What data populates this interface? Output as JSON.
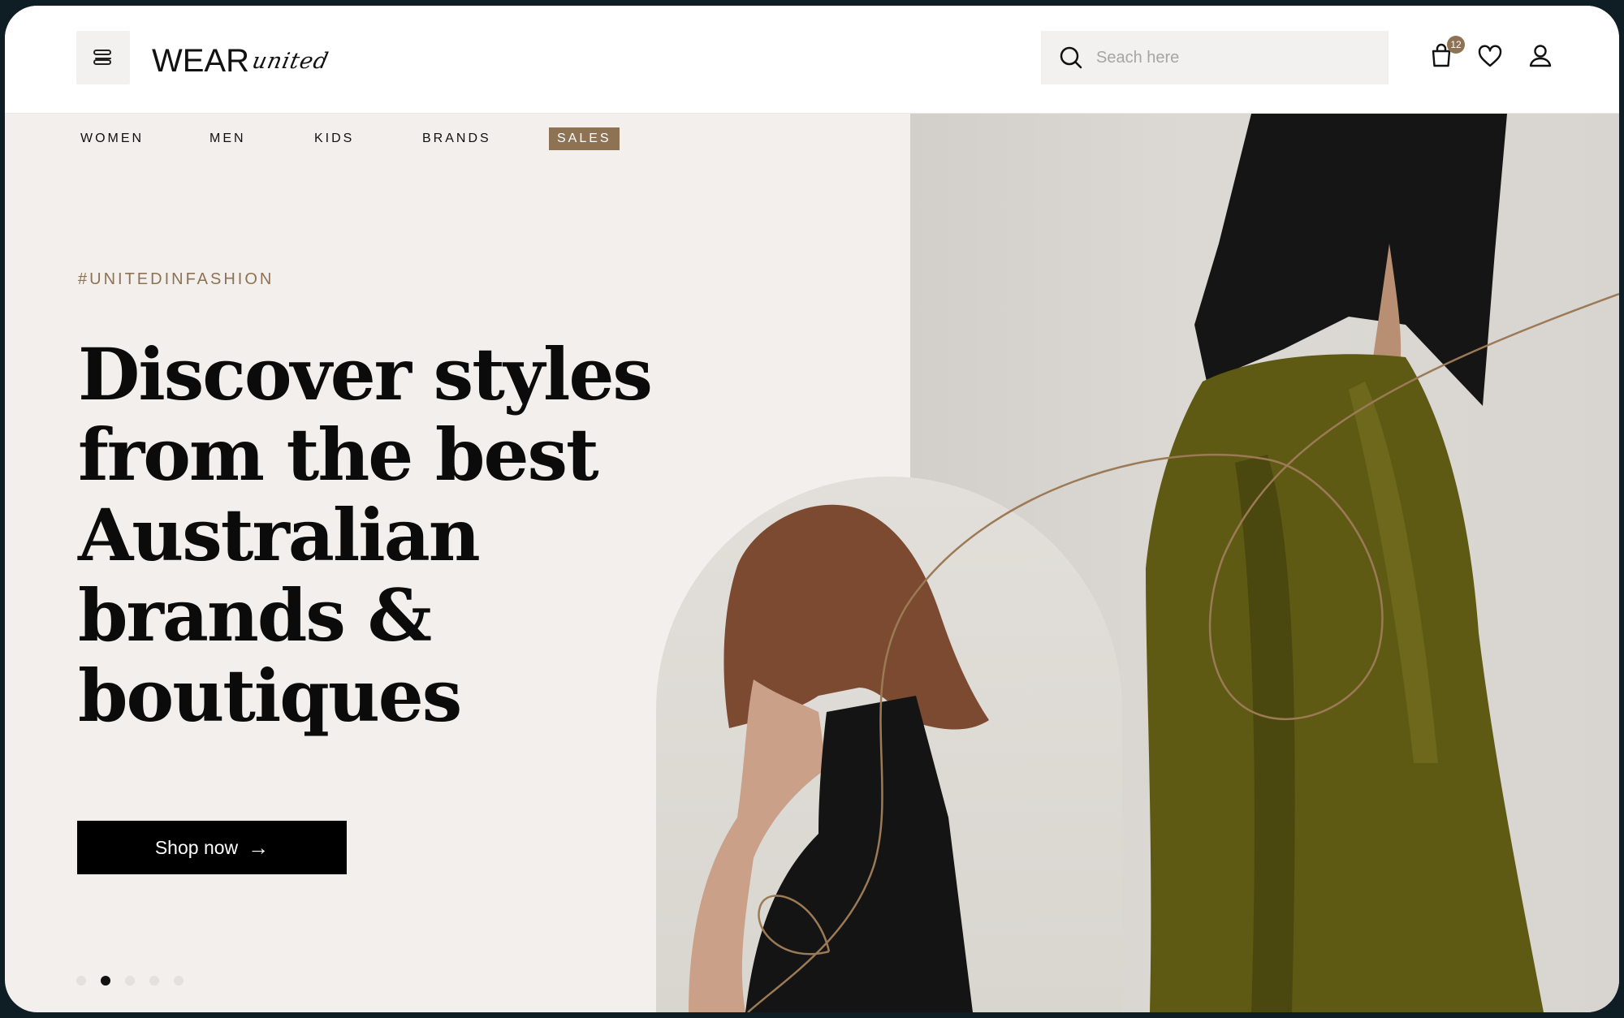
{
  "brand": {
    "wear": "WEAR",
    "united": "united"
  },
  "header": {
    "menu_icon": "menu-icon",
    "search": {
      "placeholder": "Seach here",
      "value": "",
      "icon": "search-icon"
    },
    "cart": {
      "icon": "bag-icon",
      "count": "12"
    },
    "wishlist": {
      "icon": "heart-icon"
    },
    "account": {
      "icon": "user-icon"
    }
  },
  "nav": {
    "items": [
      {
        "label": "WOMEN"
      },
      {
        "label": "MEN"
      },
      {
        "label": "KIDS"
      },
      {
        "label": "BRANDS"
      },
      {
        "label": "SALES"
      }
    ]
  },
  "hero": {
    "tag": "#UNITEDINFASHION",
    "headline": "Discover styles from the best Australian brands & boutiques",
    "cta_label": "Shop now",
    "cta_icon": "arrow-right-icon",
    "carousel": {
      "count": 5,
      "active": 2
    }
  },
  "colors": {
    "accent": "#8d7253",
    "background": "#f2efec",
    "text": "#0b0b0b",
    "button": "#000000"
  }
}
